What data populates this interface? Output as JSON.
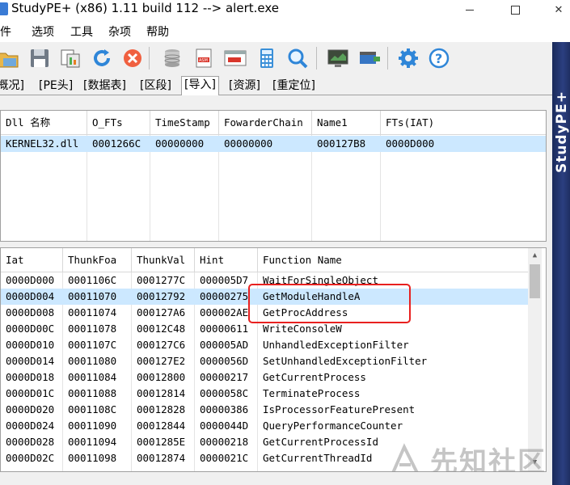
{
  "window": {
    "title": "StudyPE+ (x86) 1.11 build 112  --> alert.exe"
  },
  "menu": {
    "items": [
      "文件",
      "选项",
      "工具",
      "杂项",
      "帮助"
    ]
  },
  "toolbar": {
    "icons": [
      "open-folder-icon",
      "save-icon",
      "copy-compare-icon",
      "refresh-icon",
      "close-file-icon",
      "database-icon",
      "asm-icon",
      "asm-view-icon",
      "calculator-icon",
      "search-icon",
      "screen-icon",
      "plugin-icon",
      "settings-icon",
      "help-icon"
    ]
  },
  "side_banner": {
    "text": "StudyPE+"
  },
  "tabs": [
    {
      "label": "[概况]",
      "active": false
    },
    {
      "label": "[PE头]",
      "active": false
    },
    {
      "label": "[数据表]",
      "active": false
    },
    {
      "label": "[区段]",
      "active": false
    },
    {
      "label": "[导入]",
      "active": true
    },
    {
      "label": "[资源]",
      "active": false
    },
    {
      "label": "[重定位]",
      "active": false
    }
  ],
  "dll_table": {
    "columns": [
      "Dll 名称",
      "O_FTs",
      "TimeStamp",
      "FowarderChain",
      "Name1",
      "FTs(IAT)"
    ],
    "rows": [
      [
        "KERNEL32.dll",
        "0001266C",
        "00000000",
        "00000000",
        "000127B8",
        "0000D000"
      ]
    ]
  },
  "func_table": {
    "columns": [
      "Iat",
      "ThunkFoa",
      "ThunkVal",
      "Hint",
      "Function Name"
    ],
    "rows": [
      [
        "0000D000",
        "0001106C",
        "0001277C",
        "000005D7",
        "WaitForSingleObject"
      ],
      [
        "0000D004",
        "00011070",
        "00012792",
        "00000275",
        "GetModuleHandleA"
      ],
      [
        "0000D008",
        "00011074",
        "000127A6",
        "000002AE",
        "GetProcAddress"
      ],
      [
        "0000D00C",
        "00011078",
        "00012C48",
        "00000611",
        "WriteConsoleW"
      ],
      [
        "0000D010",
        "0001107C",
        "000127C6",
        "000005AD",
        "UnhandledExceptionFilter"
      ],
      [
        "0000D014",
        "00011080",
        "000127E2",
        "0000056D",
        "SetUnhandledExceptionFilter"
      ],
      [
        "0000D018",
        "00011084",
        "00012800",
        "00000217",
        "GetCurrentProcess"
      ],
      [
        "0000D01C",
        "00011088",
        "00012814",
        "0000058C",
        "TerminateProcess"
      ],
      [
        "0000D020",
        "0001108C",
        "00012828",
        "00000386",
        "IsProcessorFeaturePresent"
      ],
      [
        "0000D024",
        "00011090",
        "00012844",
        "0000044D",
        "QueryPerformanceCounter"
      ],
      [
        "0000D028",
        "00011094",
        "0001285E",
        "00000218",
        "GetCurrentProcessId"
      ],
      [
        "0000D02C",
        "00011098",
        "00012874",
        "0000021C",
        "GetCurrentThreadId"
      ]
    ],
    "selected_row": 1
  },
  "watermark": {
    "text": "先知社区"
  },
  "colors": {
    "selection": "#cce8ff",
    "highlight_border": "#e8201f",
    "banner": "#2b3f80"
  }
}
